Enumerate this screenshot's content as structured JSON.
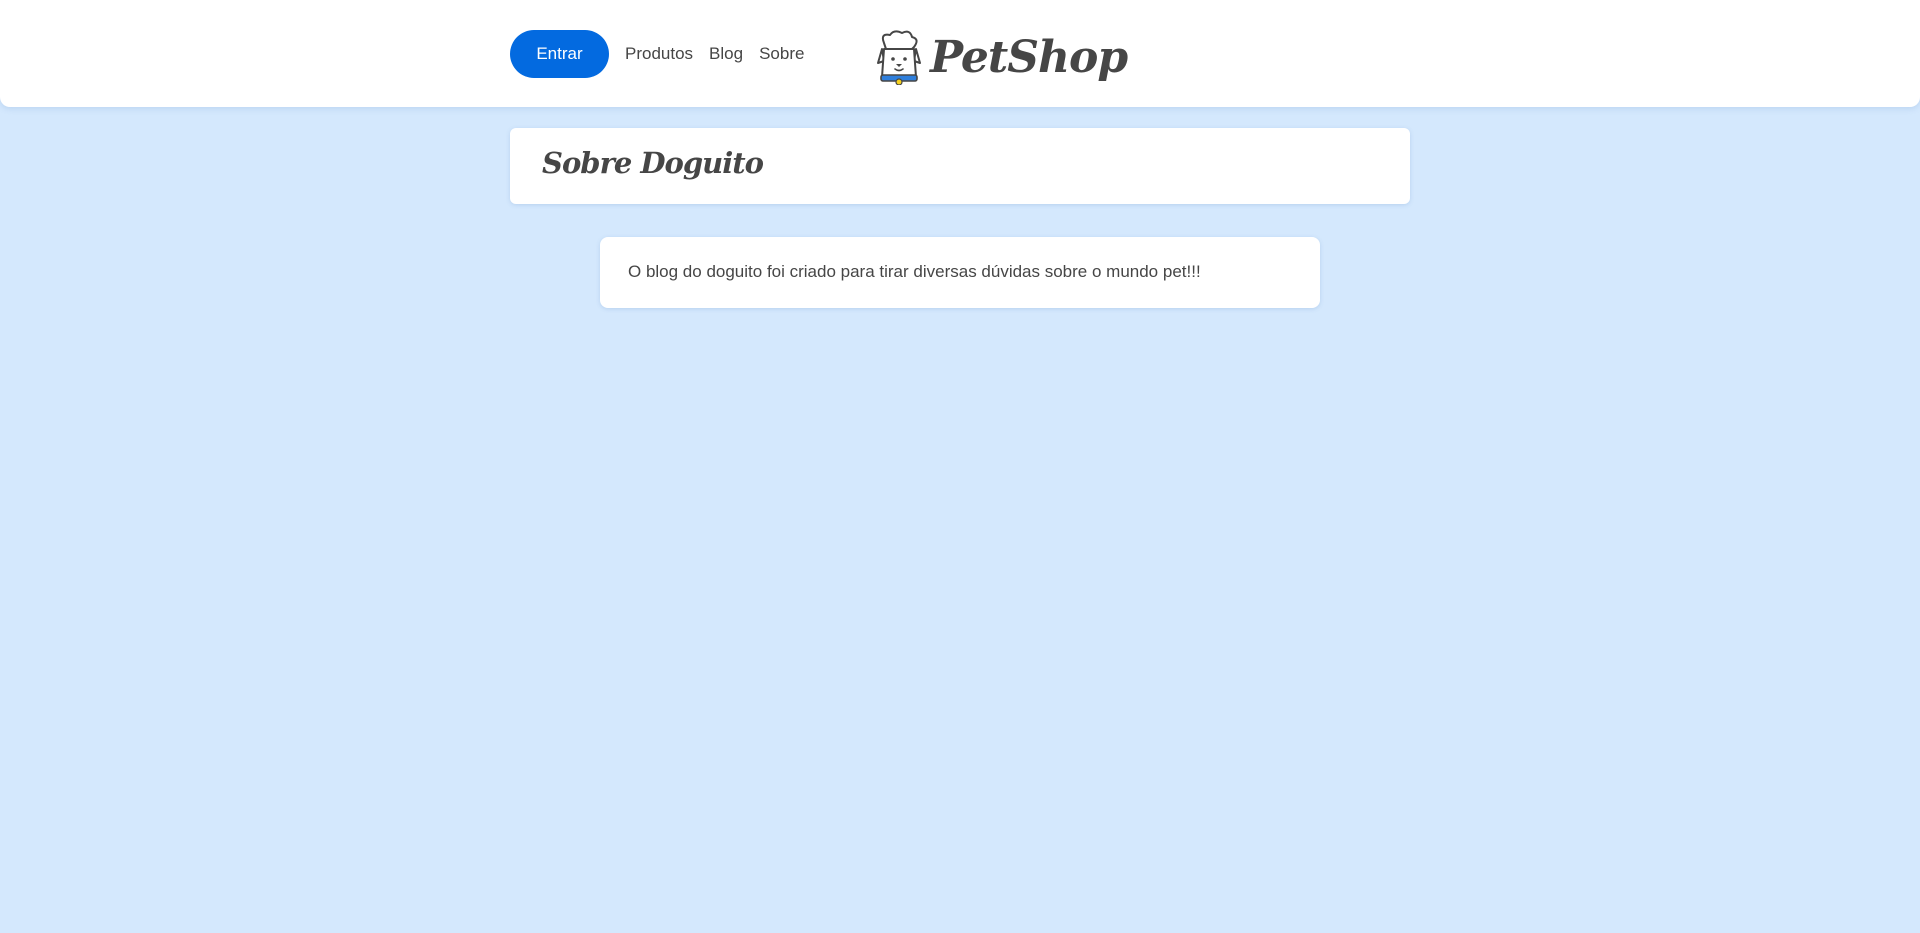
{
  "header": {
    "login_label": "Entrar",
    "nav": {
      "products": "Produtos",
      "blog": "Blog",
      "about": "Sobre"
    },
    "logo": {
      "icon": "dog-chef-icon",
      "text": "PetShop"
    }
  },
  "main": {
    "title": "Sobre Doguito",
    "body": "O blog do doguito foi criado para tirar diversas dúvidas sobre o mundo pet!!!"
  },
  "colors": {
    "background": "#d4e8fd",
    "accent": "#036ae0",
    "text": "#464646",
    "surface": "#ffffff"
  }
}
